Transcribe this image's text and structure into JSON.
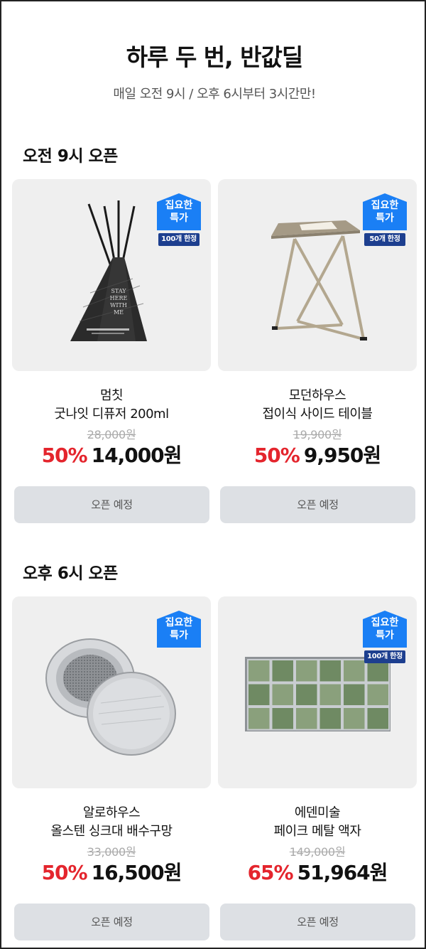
{
  "header": {
    "title": "하루 두 번, 반값딜",
    "subtitle": "매일 오전 9시 / 오후 6시부터 3시간만!"
  },
  "colors": {
    "accent_red": "#e4252d",
    "badge_blue": "#1a7ff5",
    "limit_navy": "#1d3f8f",
    "button_gray": "#dde0e4"
  },
  "sections": [
    {
      "title": "오전 9시 오픈",
      "products": [
        {
          "brand": "멈칫",
          "name": "굿나잇 디퓨저 200ml",
          "original_price": "28,000원",
          "discount": "50%",
          "sale_price": "14,000원",
          "badge": "집요한\n특가",
          "badge_line1": "집요한",
          "badge_line2": "특가",
          "limit": "100개 한정",
          "button": "오픈 예정",
          "image_icon": "diffuser-image"
        },
        {
          "brand": "모던하우스",
          "name": "접이식 사이드 테이블",
          "original_price": "19,900원",
          "discount": "50%",
          "sale_price": "9,950원",
          "badge_line1": "집요한",
          "badge_line2": "특가",
          "limit": "50개 한정",
          "button": "오픈 예정",
          "image_icon": "side-table-image"
        }
      ]
    },
    {
      "title": "오후 6시 오픈",
      "products": [
        {
          "brand": "알로하우스",
          "name": "올스텐 싱크대 배수구망",
          "original_price": "33,000원",
          "discount": "50%",
          "sale_price": "16,500원",
          "badge_line1": "집요한",
          "badge_line2": "특가",
          "limit": "",
          "button": "오픈 예정",
          "image_icon": "drain-strainer-image"
        },
        {
          "brand": "에덴미술",
          "name": "페이크 메탈 액자",
          "original_price": "149,000원",
          "discount": "65%",
          "sale_price": "51,964원",
          "badge_line1": "집요한",
          "badge_line2": "특가",
          "limit": "100개 한정",
          "button": "오픈 예정",
          "image_icon": "glass-block-frame-image"
        }
      ]
    }
  ]
}
